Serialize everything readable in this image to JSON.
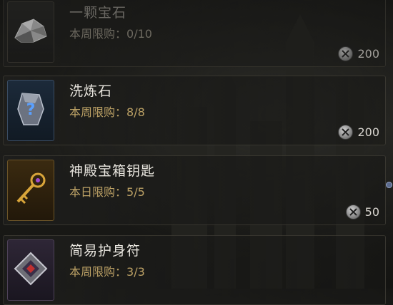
{
  "items": [
    {
      "name": "一颗宝石",
      "limit_label": "本周限购：",
      "limit_value": "0/10",
      "price": "200",
      "icon": "gem-icon",
      "currency_icon": "pickaxe-coin-icon"
    },
    {
      "name": "洗炼石",
      "limit_label": "本周限购：",
      "limit_value": "8/8",
      "price": "200",
      "icon": "mystery-stone-icon",
      "currency_icon": "pickaxe-coin-icon"
    },
    {
      "name": "神殿宝箱钥匙",
      "limit_label": "本日限购：",
      "limit_value": "5/5",
      "price": "50",
      "icon": "temple-key-icon",
      "currency_icon": "pickaxe-coin-icon"
    },
    {
      "name": "简易护身符",
      "limit_label": "本周限购：",
      "limit_value": "3/3",
      "price": "",
      "icon": "amulet-icon",
      "currency_icon": "pickaxe-coin-icon"
    }
  ]
}
